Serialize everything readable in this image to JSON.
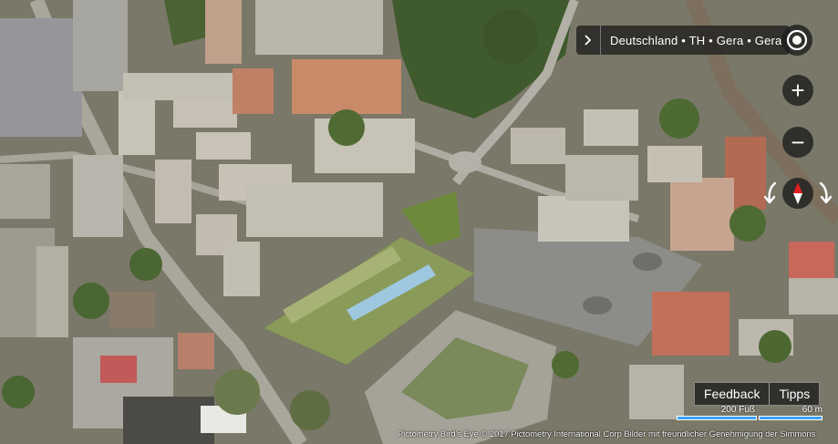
{
  "location": {
    "breadcrumb": "Deutschland • TH • Gera • Gera"
  },
  "controls": {
    "zoom_in": "+",
    "zoom_out": "−",
    "feedback_label": "Feedback",
    "tipps_label": "Tipps"
  },
  "scale": {
    "feet_label": "200 Fuß",
    "meters_label": "60 m"
  },
  "copyright": "Pictometry Bird's Eye © 2017 Pictometry International Corp Bilder mit freundlicher Genehmigung der Simmons",
  "icons": {
    "expand": "chevron-right-icon",
    "locate": "locate-me-icon",
    "rotate_left": "rotate-left-icon",
    "rotate_right": "rotate-right-icon",
    "compass": "compass-icon"
  },
  "colors": {
    "control_bg": "#1e1e1e",
    "compass_red": "#e02020",
    "scale_blue": "#3ea0ff"
  }
}
